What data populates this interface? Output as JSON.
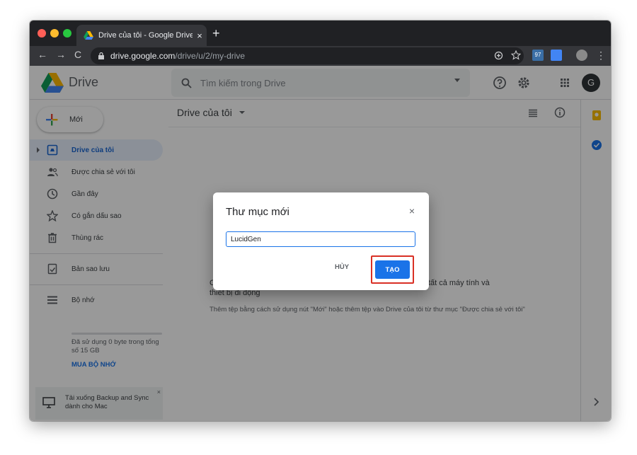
{
  "browser": {
    "tab_title": "Drive của tôi - Google Drive",
    "tab_close": "×",
    "new_tab": "+",
    "url_host": "drive.google.com",
    "url_path": "/drive/u/2/my-drive",
    "nav_back": "←",
    "nav_forward": "→",
    "nav_reload": "C",
    "ext_badge": "97",
    "menu": "⋮"
  },
  "header": {
    "product_name": "Drive",
    "search_placeholder": "Tìm kiếm trong Drive",
    "avatar_letter": "G"
  },
  "sidebar": {
    "new_label": "Mới",
    "items": [
      {
        "label": "Drive của tôi",
        "icon": "my-drive-icon",
        "active": true
      },
      {
        "label": "Được chia sẻ với tôi",
        "icon": "shared-icon"
      },
      {
        "label": "Gần đây",
        "icon": "clock-icon"
      },
      {
        "label": "Có gắn dấu sao",
        "icon": "star-icon"
      },
      {
        "label": "Thùng rác",
        "icon": "trash-icon"
      },
      {
        "label": "Bản sao lưu",
        "icon": "backup-icon"
      },
      {
        "label": "Bộ nhớ",
        "icon": "storage-icon"
      }
    ],
    "storage_text": "Đã sử dụng 0 byte trong tổng số 15 GB",
    "buy_storage": "MUA BỘ NHỚ",
    "backup_promo": "Tải xuống Backup and Sync dành cho Mac",
    "backup_close": "×"
  },
  "main": {
    "title": "Drive của tôi",
    "empty_line1_left": "C",
    "empty_line1_right": "rên tất cả máy tính và",
    "empty_line1_cont": "thiết bị di động",
    "empty_line2": "Thêm tệp bằng cách sử dụng nút \"Mới\" hoặc thêm tệp vào Drive của tôi từ thư mục \"Được chia sẻ với tôi\""
  },
  "dialog": {
    "title": "Thư mục mới",
    "close": "×",
    "input_value": "LucidGen",
    "cancel_label": "HỦY",
    "create_label": "TẠO"
  },
  "colors": {
    "accent": "#1a73e8",
    "highlight": "#d93025"
  }
}
